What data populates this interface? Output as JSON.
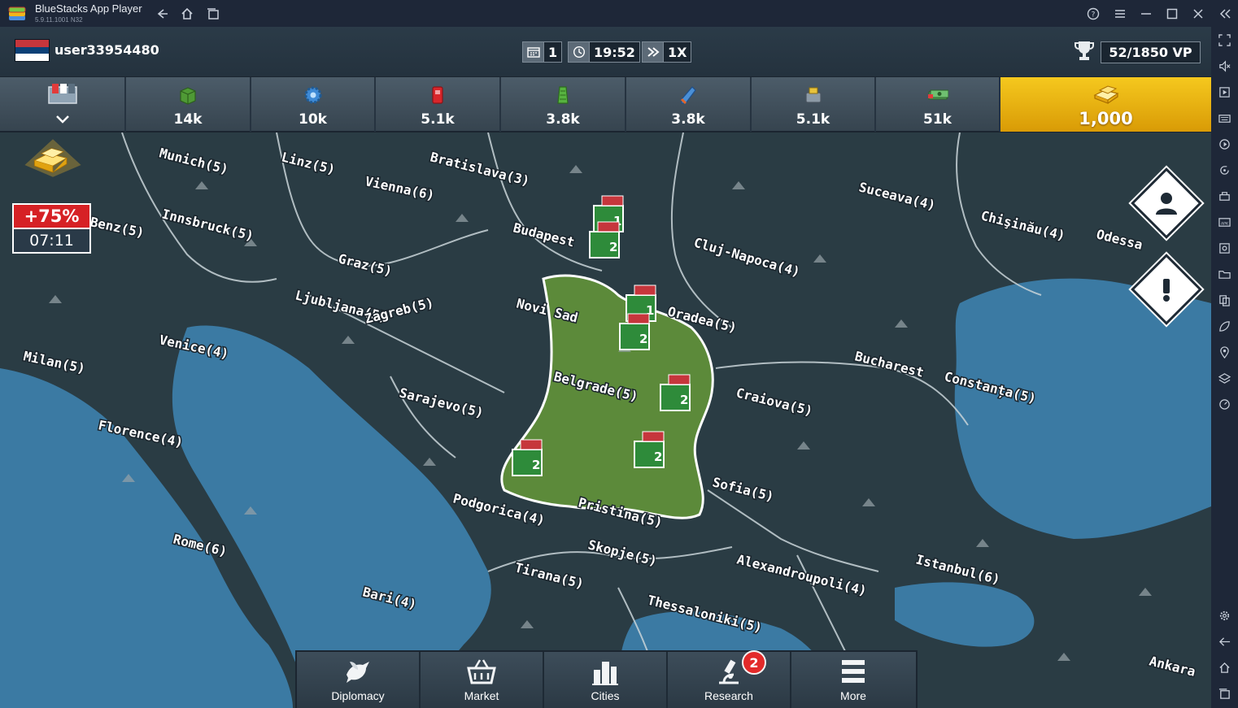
{
  "window": {
    "title": "BlueStacks App Player",
    "version": "5.9.11.1001 N32"
  },
  "player": {
    "username": "user33954480",
    "flag": "serbia-flag"
  },
  "status": {
    "turn": "1",
    "time": "19:52",
    "speed": "1X",
    "victory_points": "52/1850 VP"
  },
  "resources": [
    {
      "icon": "army-selector-icon",
      "value": ""
    },
    {
      "icon": "supplies-crate-icon",
      "value": "14k"
    },
    {
      "icon": "components-gear-icon",
      "value": "10k"
    },
    {
      "icon": "manpower-icon",
      "value": "5.1k"
    },
    {
      "icon": "rare-materials-icon",
      "value": "3.8k"
    },
    {
      "icon": "fuel-icon",
      "value": "3.8k"
    },
    {
      "icon": "electronics-icon",
      "value": "5.1k"
    },
    {
      "icon": "money-icon",
      "value": "51k"
    },
    {
      "icon": "gold-icon",
      "value": "1,000"
    }
  ],
  "bonus": {
    "percent": "+75%",
    "timer": "07:11"
  },
  "cities": [
    "Munich(5)",
    "Linz(5)",
    "Bratislava(3)",
    "Vienna(6)",
    "Innsbruck(5)",
    "Budapest",
    "Graz(5)",
    "Ljubljana(5)",
    "Zagreb(5)",
    "Venice(4)",
    "Milan(5)",
    "Novi Sad",
    "Oradea(5)",
    "Cluj-Napoca(4)",
    "Suceava(4)",
    "Chişinău(4)",
    "Odessa",
    "Belgrade(5)",
    "Sarajevo(5)",
    "Florence(4)",
    "Craiova(5)",
    "Bucharest",
    "Constanța(5)",
    "Sofia(5)",
    "Podgorica(4)",
    "Pristina(5)",
    "Skopje(5)",
    "Rome(6)",
    "Tirana(5)",
    "Bari(4)",
    "Alexandroupoli(4)",
    "Istanbul(6)",
    "Thessaloniki(5)",
    "Ankara",
    "Benz(5)"
  ],
  "units": [
    {
      "count": "1"
    },
    {
      "count": "2"
    },
    {
      "count": "1"
    },
    {
      "count": "2"
    },
    {
      "count": "2"
    },
    {
      "count": "2"
    },
    {
      "count": "2"
    }
  ],
  "bottom_nav": [
    {
      "label": "Diplomacy",
      "icon": "dove-icon"
    },
    {
      "label": "Market",
      "icon": "basket-icon"
    },
    {
      "label": "Cities",
      "icon": "buildings-icon"
    },
    {
      "label": "Research",
      "icon": "microscope-icon",
      "badge": "2"
    },
    {
      "label": "More",
      "icon": "menu-icon"
    }
  ],
  "colors": {
    "serbia_red": "#c6363c",
    "serbia_blue": "#0c4076",
    "gold": "#f5c81e",
    "water": "#3b7aa3",
    "land": "#2a3c44",
    "player_territory": "#5c8a3a"
  }
}
